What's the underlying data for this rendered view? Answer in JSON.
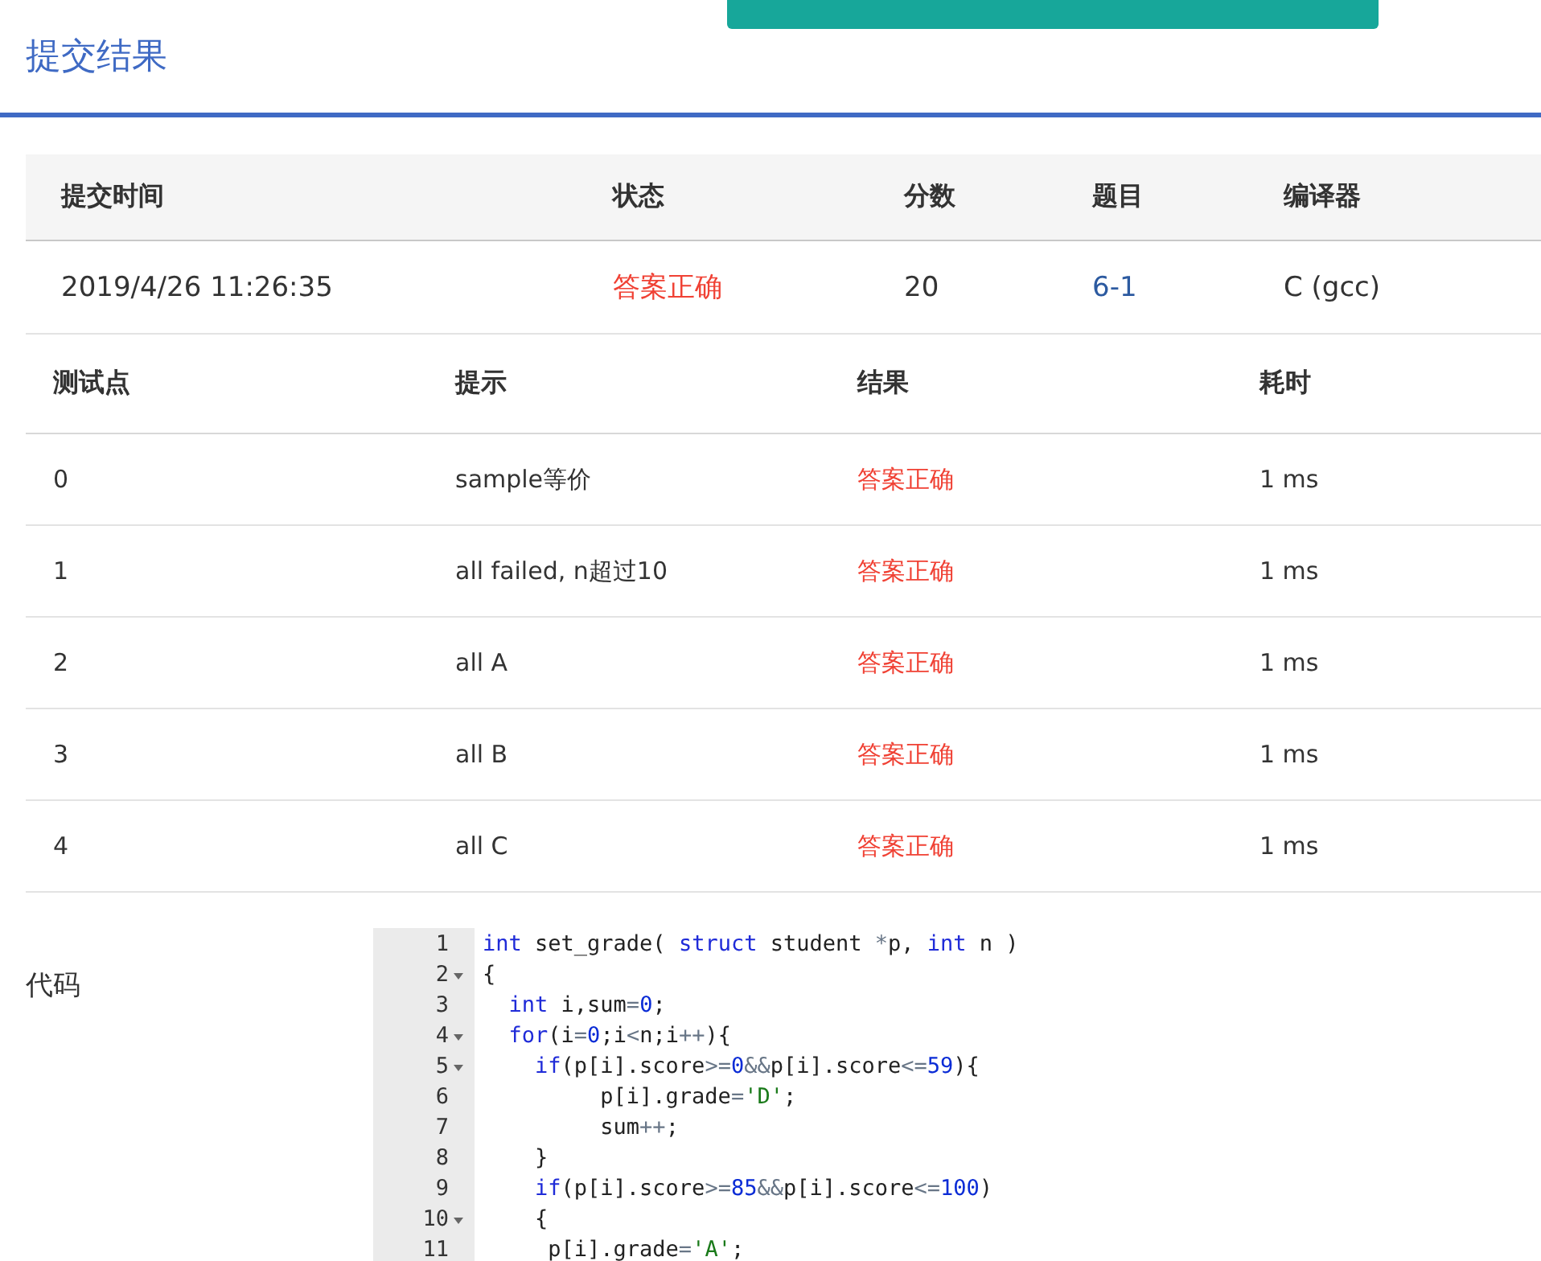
{
  "notification": {
    "kind": "toast"
  },
  "title": "提交结果",
  "summary": {
    "columns": [
      "提交时间",
      "状态",
      "分数",
      "题目",
      "编译器"
    ],
    "row": {
      "time": "2019/4/26 11:26:35",
      "status": "答案正确",
      "status_ok": true,
      "score": "20",
      "problem": "6-1",
      "compiler": "C (gcc)"
    }
  },
  "tests": {
    "columns": [
      "测试点",
      "提示",
      "结果",
      "耗时"
    ],
    "rows": [
      {
        "point": "0",
        "hint": "sample等价",
        "result": "答案正确",
        "ok": true,
        "time": "1 ms"
      },
      {
        "point": "1",
        "hint": "all failed, n超过10",
        "result": "答案正确",
        "ok": true,
        "time": "1 ms"
      },
      {
        "point": "2",
        "hint": "all A",
        "result": "答案正确",
        "ok": true,
        "time": "1 ms"
      },
      {
        "point": "3",
        "hint": "all B",
        "result": "答案正确",
        "ok": true,
        "time": "1 ms"
      },
      {
        "point": "4",
        "hint": "all C",
        "result": "答案正确",
        "ok": true,
        "time": "1 ms"
      }
    ]
  },
  "code": {
    "label": "代码",
    "lines": [
      {
        "number": "1",
        "foldable": false,
        "tokens": [
          {
            "text": "int",
            "kind": "keyword"
          },
          {
            "text": " set_grade( ",
            "kind": "plain"
          },
          {
            "text": "struct",
            "kind": "keyword"
          },
          {
            "text": " student ",
            "kind": "plain"
          },
          {
            "text": "*",
            "kind": "operator"
          },
          {
            "text": "p, ",
            "kind": "plain"
          },
          {
            "text": "int",
            "kind": "keyword"
          },
          {
            "text": " n )",
            "kind": "plain"
          }
        ]
      },
      {
        "number": "2",
        "foldable": true,
        "tokens": [
          {
            "text": "{",
            "kind": "plain"
          }
        ]
      },
      {
        "number": "3",
        "foldable": false,
        "tokens": [
          {
            "text": "  int",
            "kind": "keyword"
          },
          {
            "text": " i,sum",
            "kind": "plain"
          },
          {
            "text": "=",
            "kind": "operator"
          },
          {
            "text": "0",
            "kind": "number"
          },
          {
            "text": ";",
            "kind": "plain"
          }
        ]
      },
      {
        "number": "4",
        "foldable": true,
        "tokens": [
          {
            "text": "  for",
            "kind": "keyword"
          },
          {
            "text": "(i",
            "kind": "plain"
          },
          {
            "text": "=",
            "kind": "operator"
          },
          {
            "text": "0",
            "kind": "number"
          },
          {
            "text": ";i",
            "kind": "plain"
          },
          {
            "text": "<",
            "kind": "operator"
          },
          {
            "text": "n;i",
            "kind": "plain"
          },
          {
            "text": "++",
            "kind": "operator"
          },
          {
            "text": "){",
            "kind": "plain"
          }
        ]
      },
      {
        "number": "5",
        "foldable": true,
        "tokens": [
          {
            "text": "    if",
            "kind": "keyword"
          },
          {
            "text": "(p[i].score",
            "kind": "plain"
          },
          {
            "text": ">=",
            "kind": "operator"
          },
          {
            "text": "0",
            "kind": "number"
          },
          {
            "text": "&&",
            "kind": "operator"
          },
          {
            "text": "p[i].score",
            "kind": "plain"
          },
          {
            "text": "<=",
            "kind": "operator"
          },
          {
            "text": "59",
            "kind": "number"
          },
          {
            "text": "){",
            "kind": "plain"
          }
        ]
      },
      {
        "number": "6",
        "foldable": false,
        "tokens": [
          {
            "text": "         p[i].grade",
            "kind": "plain"
          },
          {
            "text": "=",
            "kind": "operator"
          },
          {
            "text": "'D'",
            "kind": "string"
          },
          {
            "text": ";",
            "kind": "plain"
          }
        ]
      },
      {
        "number": "7",
        "foldable": false,
        "tokens": [
          {
            "text": "         sum",
            "kind": "plain"
          },
          {
            "text": "++",
            "kind": "operator"
          },
          {
            "text": ";",
            "kind": "plain"
          }
        ]
      },
      {
        "number": "8",
        "foldable": false,
        "tokens": [
          {
            "text": "    }",
            "kind": "plain"
          }
        ]
      },
      {
        "number": "9",
        "foldable": false,
        "tokens": [
          {
            "text": "    if",
            "kind": "keyword"
          },
          {
            "text": "(p[i].score",
            "kind": "plain"
          },
          {
            "text": ">=",
            "kind": "operator"
          },
          {
            "text": "85",
            "kind": "number"
          },
          {
            "text": "&&",
            "kind": "operator"
          },
          {
            "text": "p[i].score",
            "kind": "plain"
          },
          {
            "text": "<=",
            "kind": "operator"
          },
          {
            "text": "100",
            "kind": "number"
          },
          {
            "text": ")",
            "kind": "plain"
          }
        ]
      },
      {
        "number": "10",
        "foldable": true,
        "tokens": [
          {
            "text": "    {",
            "kind": "plain"
          }
        ]
      },
      {
        "number": "11",
        "foldable": false,
        "tokens": [
          {
            "text": "     p[i].grade",
            "kind": "plain"
          },
          {
            "text": "=",
            "kind": "operator"
          },
          {
            "text": "'A'",
            "kind": "string"
          },
          {
            "text": ";",
            "kind": "plain"
          }
        ]
      }
    ]
  }
}
